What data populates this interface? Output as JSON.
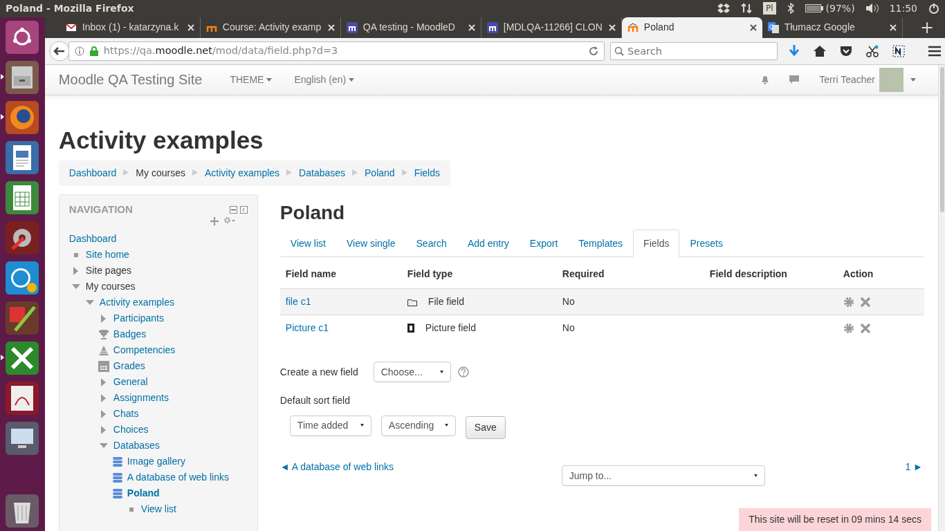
{
  "top_panel": {
    "window_title": "Poland - Mozilla Firefox",
    "keyboard_layout": "Pl",
    "battery": "(97%)",
    "time": "11:50"
  },
  "launcher": [
    {
      "running": false
    },
    {
      "running": true
    },
    {
      "running": true
    },
    {
      "running": false
    },
    {
      "running": false
    },
    {
      "running": false
    },
    {
      "running": false
    },
    {
      "running": false
    },
    {
      "running": true
    },
    {
      "running": false
    },
    {
      "running": false
    },
    {
      "running": false
    }
  ],
  "browser": {
    "tabs": [
      {
        "title": "Inbox (1) - katarzyna.k",
        "kind": "mail",
        "selected": false
      },
      {
        "title": "Course: Activity examp",
        "kind": "moodle",
        "selected": false
      },
      {
        "title": "QA testing - MoodleD",
        "kind": "tracker",
        "selected": false
      },
      {
        "title": "[MDLQA-11266] CLON",
        "kind": "tracker",
        "selected": false
      },
      {
        "title": "Poland",
        "kind": "moodle",
        "selected": true
      },
      {
        "title": "Tłumacz Google",
        "kind": "translate",
        "selected": false
      }
    ],
    "new_tab": "+",
    "url": [
      "https://qa.",
      "moodle.net",
      "/mod/data/field.php?d=3"
    ],
    "search_placeholder": "Search"
  },
  "site": {
    "brand": "Moodle QA Testing Site",
    "menus": [
      "THEME",
      "English (en)"
    ],
    "user": "Terri Teacher"
  },
  "heading": "Activity examples",
  "breadcrumb": [
    {
      "label": "Dashboard",
      "link": true
    },
    {
      "label": "My courses",
      "link": false
    },
    {
      "label": "Activity examples",
      "link": true
    },
    {
      "label": "Databases",
      "link": true
    },
    {
      "label": "Poland",
      "link": true
    },
    {
      "label": "Fields",
      "link": true
    }
  ],
  "navigation": {
    "title": "NAVIGATION",
    "tree": [
      {
        "label": "Dashboard",
        "kind": "root",
        "children": [
          {
            "label": "Site home",
            "kind": "page"
          },
          {
            "label": "Site pages",
            "kind": "category",
            "expanded": false
          },
          {
            "label": "My courses",
            "kind": "category",
            "expanded": true,
            "children": [
              {
                "label": "Activity examples",
                "kind": "branch",
                "expanded": true,
                "children": [
                  {
                    "label": "Participants",
                    "kind": "branch",
                    "expanded": false
                  },
                  {
                    "label": "Badges",
                    "kind": "trophy"
                  },
                  {
                    "label": "Competencies",
                    "kind": "pyramid"
                  },
                  {
                    "label": "Grades",
                    "kind": "grid"
                  },
                  {
                    "label": "General",
                    "kind": "branch",
                    "expanded": false
                  },
                  {
                    "label": "Assignments",
                    "kind": "branch",
                    "expanded": false
                  },
                  {
                    "label": "Chats",
                    "kind": "branch",
                    "expanded": false
                  },
                  {
                    "label": "Choices",
                    "kind": "branch",
                    "expanded": false
                  },
                  {
                    "label": "Databases",
                    "kind": "branch",
                    "expanded": true,
                    "children": [
                      {
                        "label": "Image gallery",
                        "kind": "database",
                        "active": false
                      },
                      {
                        "label": "A database of web links",
                        "kind": "database",
                        "active": false
                      },
                      {
                        "label": "Poland",
                        "kind": "database",
                        "active": true,
                        "children": [
                          {
                            "label": "View list",
                            "kind": "page"
                          }
                        ]
                      }
                    ]
                  }
                ]
              }
            ]
          }
        ]
      }
    ]
  },
  "main": {
    "title": "Poland",
    "tabs": [
      {
        "label": "View list",
        "selected": false
      },
      {
        "label": "View single",
        "selected": false
      },
      {
        "label": "Search",
        "selected": false
      },
      {
        "label": "Add entry",
        "selected": false
      },
      {
        "label": "Export",
        "selected": false
      },
      {
        "label": "Templates",
        "selected": false
      },
      {
        "label": "Fields",
        "selected": true
      },
      {
        "label": "Presets",
        "selected": false
      }
    ],
    "columns": [
      "Field name",
      "Field type",
      "Required",
      "Field description",
      "Action"
    ],
    "rows": [
      {
        "name": "file c1",
        "kind": "file",
        "type": "File field",
        "required": "No"
      },
      {
        "name": "Picture c1",
        "kind": "picture",
        "type": "Picture field",
        "required": "No"
      }
    ],
    "create_label": "Create a new field",
    "create_value": "Choose...",
    "sort_label": "Default sort field",
    "sort_field": "Time added",
    "sort_order": "Ascending",
    "save": "Save",
    "prev_link": "◄ A database of web links",
    "next_link": "1 ►",
    "jump": "Jump to..."
  },
  "reset_notice": "This site will be reset in 09 mins 14 secs"
}
